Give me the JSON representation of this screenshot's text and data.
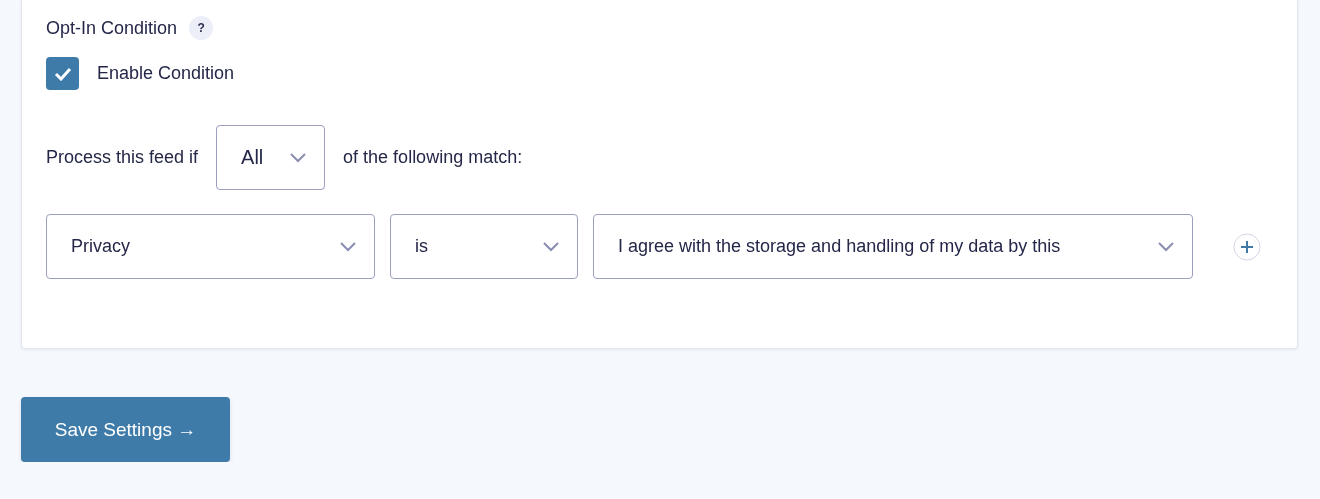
{
  "section": {
    "title": "Opt-In Condition",
    "help": "?"
  },
  "enable_condition": {
    "label": "Enable Condition",
    "checked": true
  },
  "match_row": {
    "prefix": "Process this feed if",
    "select": {
      "value": "All"
    },
    "suffix": "of the following match:"
  },
  "rules": [
    {
      "field": "Privacy",
      "operator": "is",
      "value": "I agree with the storage and handling of my data by this"
    }
  ],
  "save_button": {
    "label": "Save Settings →"
  }
}
